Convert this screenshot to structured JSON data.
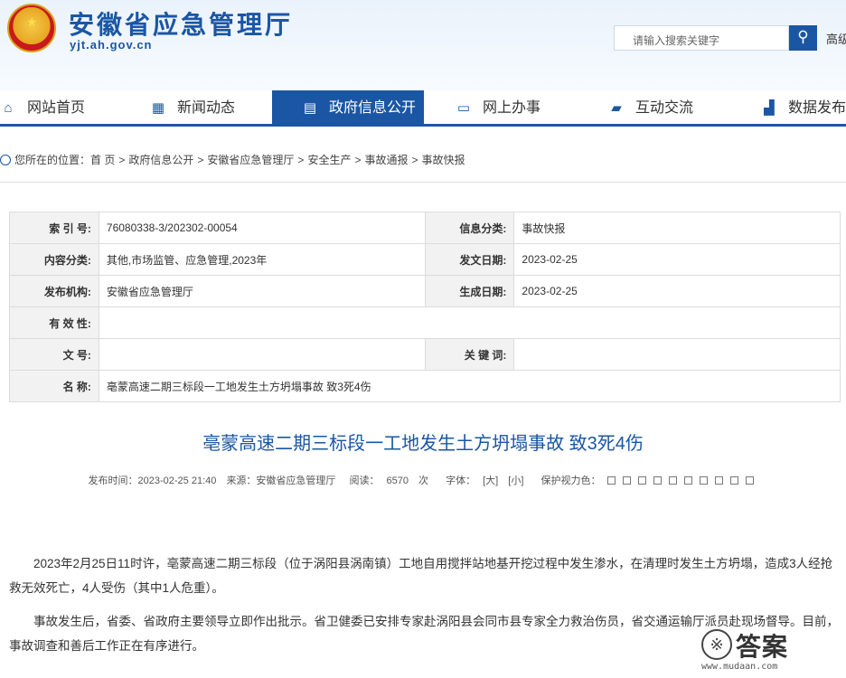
{
  "header": {
    "site_name": "安徽省应急管理厅",
    "site_url": "yjt.ah.gov.cn",
    "search_placeholder": "请输入搜索关键字",
    "adv_search_label": "高级"
  },
  "nav": [
    {
      "label": "网站首页",
      "icon": "home-icon"
    },
    {
      "label": "新闻动态",
      "icon": "news-icon"
    },
    {
      "label": "政府信息公开",
      "icon": "document-icon",
      "active": true
    },
    {
      "label": "网上办事",
      "icon": "monitor-icon"
    },
    {
      "label": "互动交流",
      "icon": "chat-icon"
    },
    {
      "label": "数据发布",
      "icon": "chart-icon"
    }
  ],
  "breadcrumb": {
    "prefix": "您所在的位置：",
    "items": [
      "首 页",
      "政府信息公开",
      "安徽省应急管理厅",
      "安全生产",
      "事故通报",
      "事故快报"
    ]
  },
  "meta": {
    "index_label": "索 引 号:",
    "index_value": "76080338-3/202302-00054",
    "category_label": "信息分类:",
    "category_value": "事故快报",
    "content_label": "内容分类:",
    "content_value": "其他,市场监管、应急管理,2023年",
    "pubdate_label": "发文日期:",
    "pubdate_value": "2023-02-25",
    "org_label": "发布机构:",
    "org_value": "安徽省应急管理厅",
    "gendate_label": "生成日期:",
    "gendate_value": "2023-02-25",
    "validity_label": "有 效 性:",
    "validity_value": "",
    "docno_label": "文 号:",
    "docno_value": "",
    "keyword_label": "关 键 词:",
    "keyword_value": "",
    "name_label": "名 称:",
    "name_value": "亳蒙高速二期三标段一工地发生土方坍塌事故 致3死4伤"
  },
  "article": {
    "title": "亳蒙高速二期三标段一工地发生土方坍塌事故 致3死4伤",
    "publish_time": "发布时间：2023-02-25 21:40",
    "source": "来源：安徽省应急管理厅",
    "views_label": "阅读：",
    "views": "6570",
    "views_unit": "次",
    "font_label": "字体：",
    "font_big": "[大]",
    "font_small": "[小]",
    "eye_label": "保护视力色：",
    "paragraphs": [
      "2023年2月25日11时许，亳蒙高速二期三标段（位于涡阳县涡南镇）工地自用搅拌站地基开挖过程中发生渗水，在清理时发生土方坍塌，造成3人经抢救无效死亡，4人受伤（其中1人危重）。",
      "事故发生后，省委、省政府主要领导立即作出批示。省卫健委已安排专家赴涡阳县会同市县专家全力救治伤员，省交通运输厅派员赴现场督导。目前，事故调查和善后工作正在有序进行。"
    ]
  },
  "watermark": {
    "text": "答案",
    "url": "www.mudaan.com"
  }
}
